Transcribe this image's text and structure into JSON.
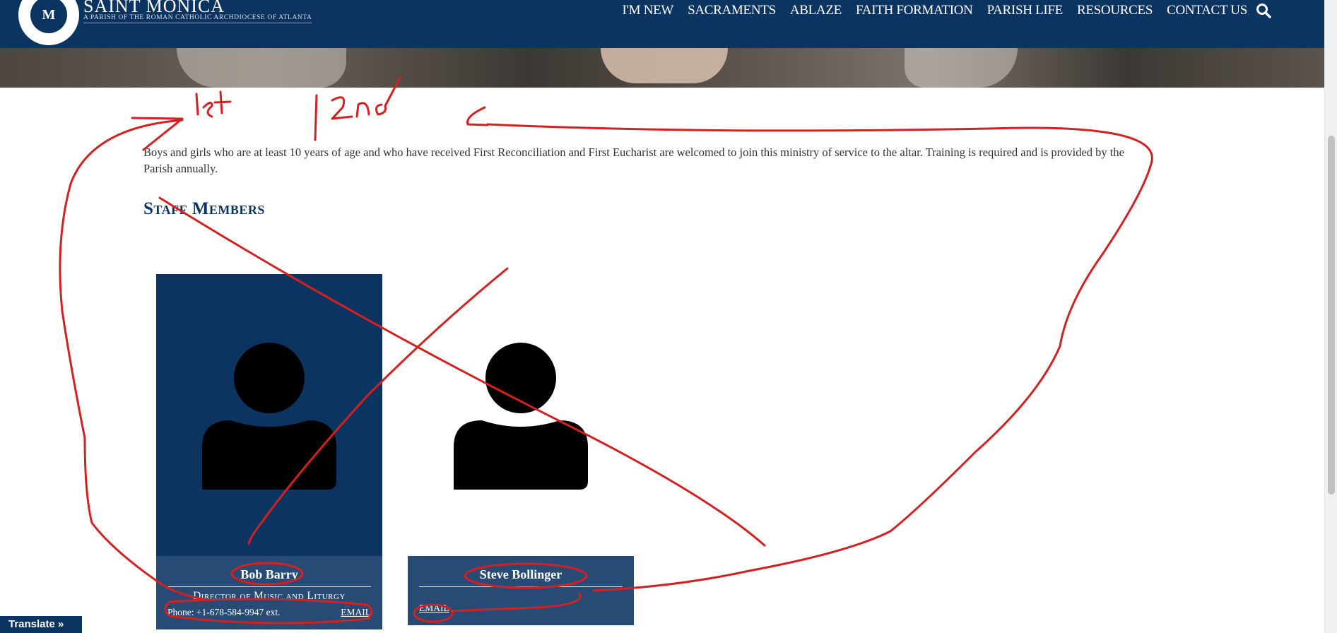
{
  "header": {
    "brand_name": "SAINT MONICA",
    "brand_sub": "A PARISH OF THE ROMAN CATHOLIC ARCHDIOCESE OF ATLANTA",
    "logo_text": "M",
    "nav": [
      "I'M NEW",
      "SACRAMENTS",
      "ABLAZE",
      "FAITH FORMATION",
      "PARISH LIFE",
      "RESOURCES",
      "CONTACT US"
    ]
  },
  "intro_text": "Boys and girls who are at least 10 years of age and who have received First Reconciliation and First Eucharist are welcomed to join this ministry of service to the altar. Training is required and is provided by the Parish annually.",
  "staff_heading": "Staff Members",
  "staff": [
    {
      "name": "Bob Barry",
      "title": "Director of Music and Liturgy",
      "phone": "Phone: +1-678-584-9947 ext.",
      "email_label": "EMAIL"
    },
    {
      "name": "Steve Bollinger",
      "email_label": "EMAIL"
    }
  ],
  "annotations": {
    "first": "1st",
    "second": "2nd"
  },
  "translate_label": "Translate »",
  "colors": {
    "navy": "#0c3460",
    "card_info": "#274b74",
    "annotation_red": "#d42020"
  }
}
